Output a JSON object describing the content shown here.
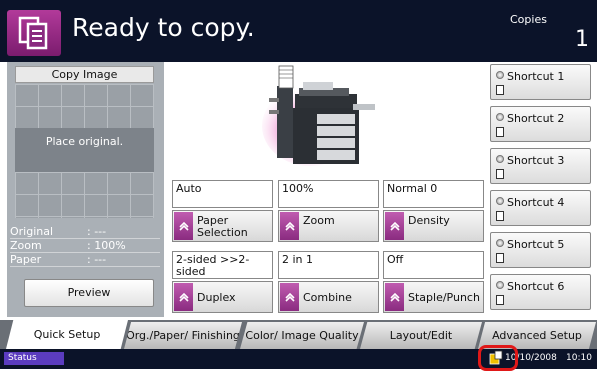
{
  "header": {
    "title": "Ready to copy.",
    "copies_label": "Copies",
    "copies_count": "1"
  },
  "preview": {
    "panel_label": "Copy Image",
    "placeholder": "Place original.",
    "info": [
      {
        "key": "Original",
        "value": ": ---"
      },
      {
        "key": "Zoom",
        "value": ": 100%"
      },
      {
        "key": "Paper",
        "value": ": ---"
      }
    ],
    "preview_button": "Preview"
  },
  "functions": [
    {
      "value": "Auto",
      "label": "Paper Selection"
    },
    {
      "value": "100%",
      "label": "Zoom"
    },
    {
      "value": "Normal 0",
      "label": "Density"
    },
    {
      "value": "2-sided >>2-sided",
      "label": "Duplex"
    },
    {
      "value": "2 in 1",
      "label": "Combine"
    },
    {
      "value": "Off",
      "label": "Staple/Punch"
    }
  ],
  "shortcuts": [
    "Shortcut 1",
    "Shortcut 2",
    "Shortcut 3",
    "Shortcut 4",
    "Shortcut 5",
    "Shortcut 6"
  ],
  "tabs": [
    "Quick Setup",
    "Org./Paper/ Finishing",
    "Color/ Image Quality",
    "Layout/Edit",
    "Advanced Setup"
  ],
  "status": {
    "label": "Status",
    "date": "10/10/2008",
    "time": "10:10"
  },
  "colors": {
    "header_bg": "#0b1329",
    "accent_magenta": "#9a2f8c",
    "status_badge": "#5b3cbf",
    "highlight": "#e01818"
  }
}
